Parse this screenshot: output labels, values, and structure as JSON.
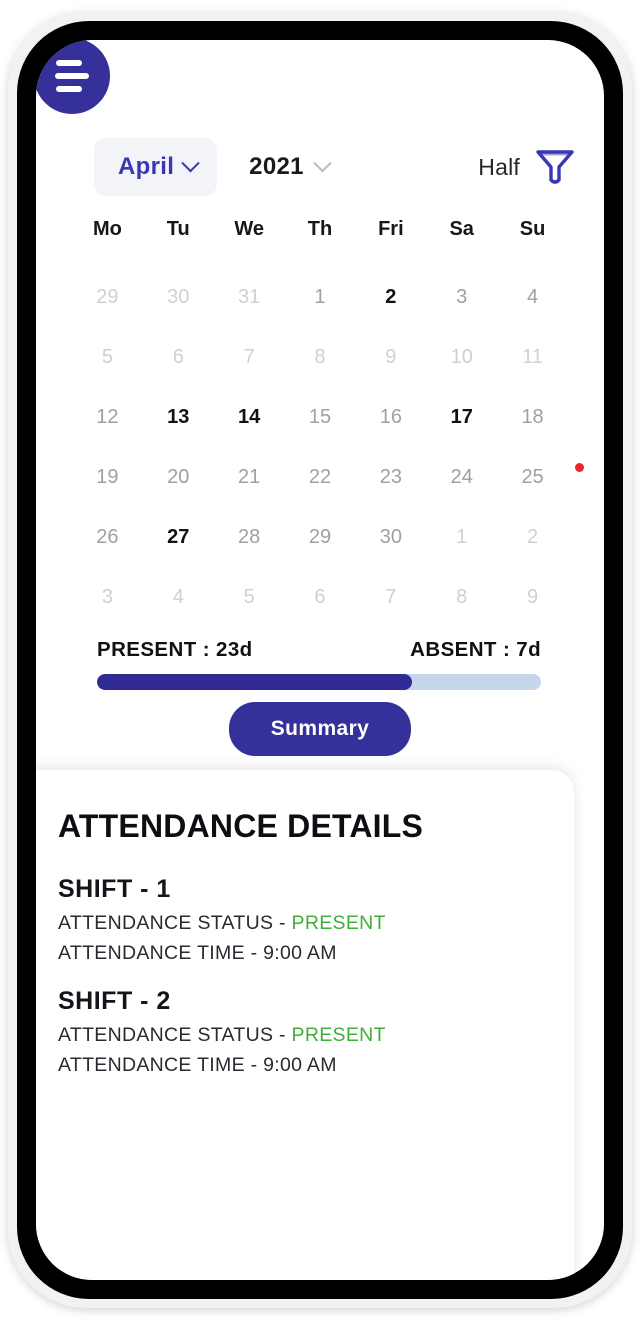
{
  "header": {
    "menu_icon": "hamburger-menu-icon"
  },
  "selectors": {
    "month": "April",
    "month_chevron": "chevron-down-icon",
    "year": "2021",
    "year_chevron": "chevron-down-icon",
    "filter_label": "Half",
    "filter_icon": "funnel-filter-icon"
  },
  "calendar": {
    "weekdays": [
      "Mo",
      "Tu",
      "We",
      "Th",
      "Fri",
      "Sa",
      "Su"
    ],
    "weeks": [
      [
        {
          "day": "29",
          "style": "muted"
        },
        {
          "day": "30",
          "style": "muted"
        },
        {
          "day": "31",
          "style": "muted"
        },
        {
          "day": "1",
          "style": "normal"
        },
        {
          "day": "2",
          "style": "strong"
        },
        {
          "day": "3",
          "style": "normal"
        },
        {
          "day": "4",
          "style": "normal"
        }
      ],
      [
        {
          "day": "5",
          "style": "muted"
        },
        {
          "day": "6",
          "style": "muted"
        },
        {
          "day": "7",
          "style": "muted"
        },
        {
          "day": "8",
          "style": "muted"
        },
        {
          "day": "9",
          "style": "muted"
        },
        {
          "day": "10",
          "style": "muted"
        },
        {
          "day": "11",
          "style": "muted"
        }
      ],
      [
        {
          "day": "12",
          "style": "normal"
        },
        {
          "day": "13",
          "style": "strong"
        },
        {
          "day": "14",
          "style": "strong"
        },
        {
          "day": "15",
          "style": "normal"
        },
        {
          "day": "16",
          "style": "normal"
        },
        {
          "day": "17",
          "style": "strong"
        },
        {
          "day": "18",
          "style": "normal"
        }
      ],
      [
        {
          "day": "19",
          "style": "normal"
        },
        {
          "day": "20",
          "style": "normal"
        },
        {
          "day": "21",
          "style": "normal"
        },
        {
          "day": "22",
          "style": "normal"
        },
        {
          "day": "23",
          "style": "normal"
        },
        {
          "day": "24",
          "style": "normal"
        },
        {
          "day": "25",
          "style": "normal",
          "dot": true
        }
      ],
      [
        {
          "day": "26",
          "style": "normal"
        },
        {
          "day": "27",
          "style": "strong"
        },
        {
          "day": "28",
          "style": "normal"
        },
        {
          "day": "29",
          "style": "normal"
        },
        {
          "day": "30",
          "style": "normal"
        },
        {
          "day": "1",
          "style": "muted"
        },
        {
          "day": "2",
          "style": "muted"
        }
      ],
      [
        {
          "day": "3",
          "style": "muted"
        },
        {
          "day": "4",
          "style": "muted"
        },
        {
          "day": "5",
          "style": "muted"
        },
        {
          "day": "6",
          "style": "muted"
        },
        {
          "day": "7",
          "style": "muted"
        },
        {
          "day": "8",
          "style": "muted"
        },
        {
          "day": "9",
          "style": "muted"
        }
      ]
    ]
  },
  "stats": {
    "present_label": "PRESENT : 23d",
    "absent_label": "ABSENT : 7d",
    "present_days": 23,
    "absent_days": 7,
    "fill_percent": 71,
    "fill_color": "#2f2a94",
    "track_color": "#c6d4ec"
  },
  "summary_button": {
    "label": "Summary"
  },
  "details": {
    "title": "ATTENDANCE DETAILS",
    "shifts": [
      {
        "title": "SHIFT - 1",
        "status_label": "ATTENDANCE STATUS - ",
        "status_value": "PRESENT",
        "time_line": "ATTENDANCE TIME - 9:00 AM"
      },
      {
        "title": "SHIFT - 2",
        "status_label": "ATTENDANCE STATUS - ",
        "status_value": "PRESENT",
        "time_line": "ATTENDANCE TIME - 9:00 AM"
      }
    ]
  },
  "colors": {
    "brand_indigo": "#35309a",
    "accent_blue": "#3b36b4",
    "status_green": "#3fae3b",
    "dot_red": "#e8252a"
  }
}
